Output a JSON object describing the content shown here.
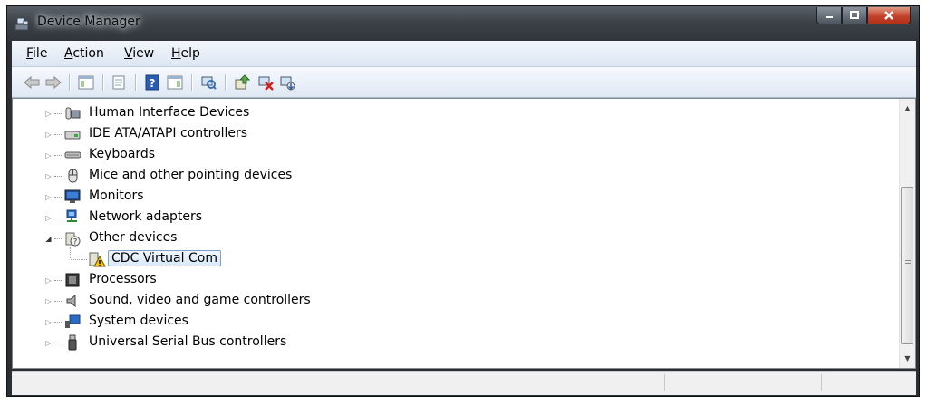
{
  "window": {
    "title": "Device Manager",
    "app_icon": "device-manager-icon",
    "caption_buttons": [
      "minimize",
      "maximize",
      "close"
    ]
  },
  "menu": {
    "items": [
      {
        "pre": "",
        "u": "F",
        "post": "ile"
      },
      {
        "pre": "",
        "u": "A",
        "post": "ction"
      },
      {
        "pre": "",
        "u": "V",
        "post": "iew"
      },
      {
        "pre": "",
        "u": "H",
        "post": "elp"
      }
    ]
  },
  "toolbar": {
    "buttons": [
      "back-arrow-icon",
      "forward-arrow-icon",
      "show-hide-console-tree-icon",
      "properties-icon",
      "help-icon",
      "show-action-pane-icon",
      "scan-hardware-icon",
      "update-driver-icon",
      "disable-device-icon",
      "uninstall-device-icon"
    ]
  },
  "tree": {
    "nodes": [
      {
        "label": "Human Interface Devices",
        "icon": "hid-icon",
        "expanded": false
      },
      {
        "label": "IDE ATA/ATAPI controllers",
        "icon": "ide-controller-icon",
        "expanded": false
      },
      {
        "label": "Keyboards",
        "icon": "keyboard-icon",
        "expanded": false
      },
      {
        "label": "Mice and other pointing devices",
        "icon": "mouse-icon",
        "expanded": false
      },
      {
        "label": "Monitors",
        "icon": "monitor-icon",
        "expanded": false
      },
      {
        "label": "Network adapters",
        "icon": "network-adapter-icon",
        "expanded": false
      },
      {
        "label": "Other devices",
        "icon": "other-devices-icon",
        "expanded": true
      },
      {
        "label": "CDC Virtual Com",
        "icon": "warning-device-icon",
        "child": true,
        "selected": true
      },
      {
        "label": "Processors",
        "icon": "processor-icon",
        "expanded": false
      },
      {
        "label": "Sound, video and game controllers",
        "icon": "speaker-icon",
        "expanded": false
      },
      {
        "label": "System devices",
        "icon": "system-devices-icon",
        "expanded": false
      },
      {
        "label": "Universal Serial Bus controllers",
        "icon": "usb-icon",
        "expanded": false
      }
    ]
  },
  "status": {
    "text": ""
  }
}
